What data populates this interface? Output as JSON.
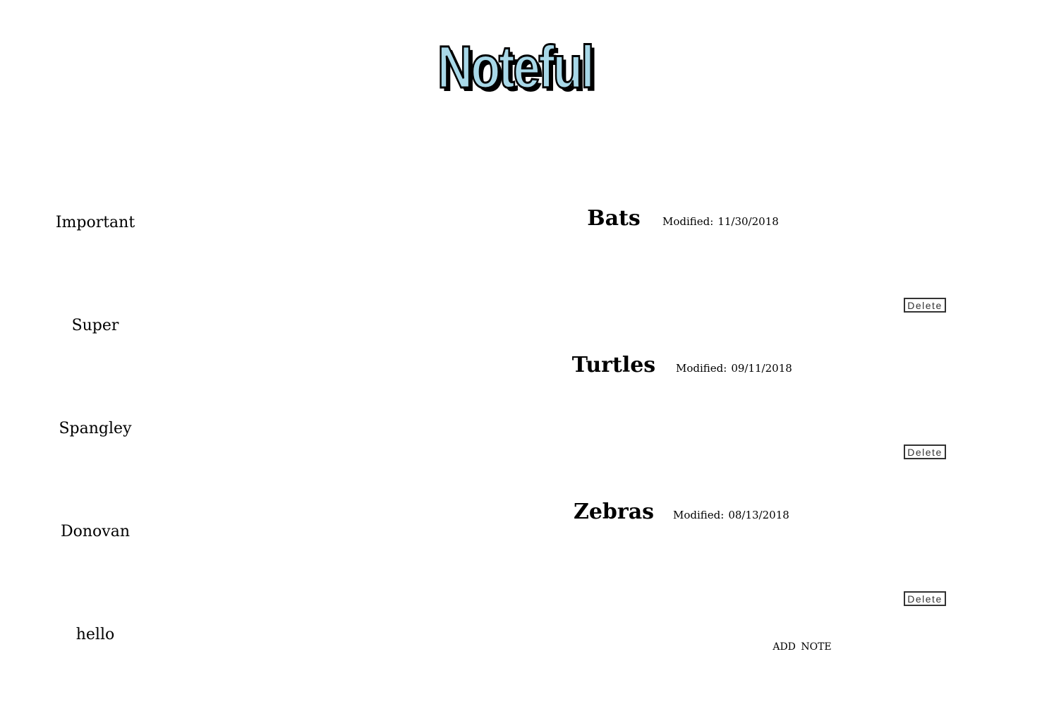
{
  "header": {
    "title": "Noteful"
  },
  "colors": {
    "logo_fill": "#a8d8e8",
    "logo_outline": "#000000",
    "background": "#ffffff"
  },
  "sidebar": {
    "folders": [
      {
        "label": "Important"
      },
      {
        "label": "Super"
      },
      {
        "label": "Spangley"
      },
      {
        "label": "Donovan"
      },
      {
        "label": "hello"
      }
    ]
  },
  "main": {
    "notes": [
      {
        "title": "Bats",
        "modified_label": "Modified:",
        "modified_date": "11/30/2018",
        "delete_label": "Delete"
      },
      {
        "title": "Turtles",
        "modified_label": "Modified:",
        "modified_date": "09/11/2018",
        "delete_label": "Delete"
      },
      {
        "title": "Zebras",
        "modified_label": "Modified:",
        "modified_date": "08/13/2018",
        "delete_label": "Delete"
      }
    ],
    "add_note_label": "ADD NOTE"
  }
}
